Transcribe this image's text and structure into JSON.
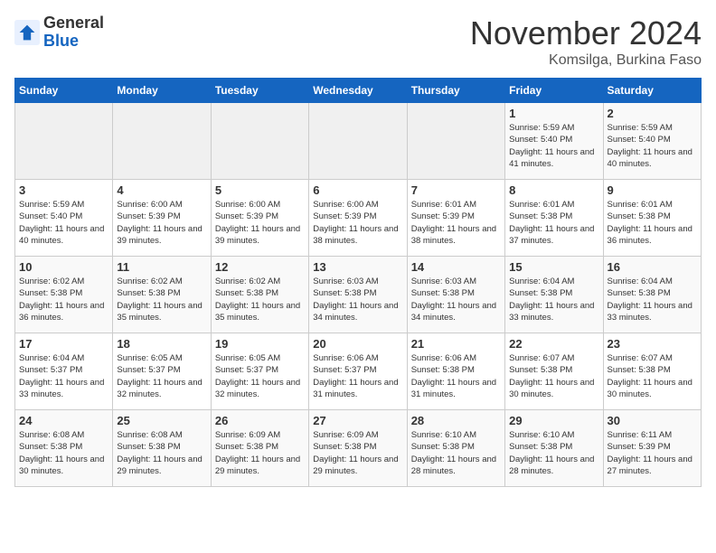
{
  "logo": {
    "general": "General",
    "blue": "Blue"
  },
  "title": "November 2024",
  "location": "Komsilga, Burkina Faso",
  "days_header": [
    "Sunday",
    "Monday",
    "Tuesday",
    "Wednesday",
    "Thursday",
    "Friday",
    "Saturday"
  ],
  "weeks": [
    [
      {
        "day": "",
        "info": ""
      },
      {
        "day": "",
        "info": ""
      },
      {
        "day": "",
        "info": ""
      },
      {
        "day": "",
        "info": ""
      },
      {
        "day": "",
        "info": ""
      },
      {
        "day": "1",
        "info": "Sunrise: 5:59 AM\nSunset: 5:40 PM\nDaylight: 11 hours and 41 minutes."
      },
      {
        "day": "2",
        "info": "Sunrise: 5:59 AM\nSunset: 5:40 PM\nDaylight: 11 hours and 40 minutes."
      }
    ],
    [
      {
        "day": "3",
        "info": "Sunrise: 5:59 AM\nSunset: 5:40 PM\nDaylight: 11 hours and 40 minutes."
      },
      {
        "day": "4",
        "info": "Sunrise: 6:00 AM\nSunset: 5:39 PM\nDaylight: 11 hours and 39 minutes."
      },
      {
        "day": "5",
        "info": "Sunrise: 6:00 AM\nSunset: 5:39 PM\nDaylight: 11 hours and 39 minutes."
      },
      {
        "day": "6",
        "info": "Sunrise: 6:00 AM\nSunset: 5:39 PM\nDaylight: 11 hours and 38 minutes."
      },
      {
        "day": "7",
        "info": "Sunrise: 6:01 AM\nSunset: 5:39 PM\nDaylight: 11 hours and 38 minutes."
      },
      {
        "day": "8",
        "info": "Sunrise: 6:01 AM\nSunset: 5:38 PM\nDaylight: 11 hours and 37 minutes."
      },
      {
        "day": "9",
        "info": "Sunrise: 6:01 AM\nSunset: 5:38 PM\nDaylight: 11 hours and 36 minutes."
      }
    ],
    [
      {
        "day": "10",
        "info": "Sunrise: 6:02 AM\nSunset: 5:38 PM\nDaylight: 11 hours and 36 minutes."
      },
      {
        "day": "11",
        "info": "Sunrise: 6:02 AM\nSunset: 5:38 PM\nDaylight: 11 hours and 35 minutes."
      },
      {
        "day": "12",
        "info": "Sunrise: 6:02 AM\nSunset: 5:38 PM\nDaylight: 11 hours and 35 minutes."
      },
      {
        "day": "13",
        "info": "Sunrise: 6:03 AM\nSunset: 5:38 PM\nDaylight: 11 hours and 34 minutes."
      },
      {
        "day": "14",
        "info": "Sunrise: 6:03 AM\nSunset: 5:38 PM\nDaylight: 11 hours and 34 minutes."
      },
      {
        "day": "15",
        "info": "Sunrise: 6:04 AM\nSunset: 5:38 PM\nDaylight: 11 hours and 33 minutes."
      },
      {
        "day": "16",
        "info": "Sunrise: 6:04 AM\nSunset: 5:38 PM\nDaylight: 11 hours and 33 minutes."
      }
    ],
    [
      {
        "day": "17",
        "info": "Sunrise: 6:04 AM\nSunset: 5:37 PM\nDaylight: 11 hours and 33 minutes."
      },
      {
        "day": "18",
        "info": "Sunrise: 6:05 AM\nSunset: 5:37 PM\nDaylight: 11 hours and 32 minutes."
      },
      {
        "day": "19",
        "info": "Sunrise: 6:05 AM\nSunset: 5:37 PM\nDaylight: 11 hours and 32 minutes."
      },
      {
        "day": "20",
        "info": "Sunrise: 6:06 AM\nSunset: 5:37 PM\nDaylight: 11 hours and 31 minutes."
      },
      {
        "day": "21",
        "info": "Sunrise: 6:06 AM\nSunset: 5:38 PM\nDaylight: 11 hours and 31 minutes."
      },
      {
        "day": "22",
        "info": "Sunrise: 6:07 AM\nSunset: 5:38 PM\nDaylight: 11 hours and 30 minutes."
      },
      {
        "day": "23",
        "info": "Sunrise: 6:07 AM\nSunset: 5:38 PM\nDaylight: 11 hours and 30 minutes."
      }
    ],
    [
      {
        "day": "24",
        "info": "Sunrise: 6:08 AM\nSunset: 5:38 PM\nDaylight: 11 hours and 30 minutes."
      },
      {
        "day": "25",
        "info": "Sunrise: 6:08 AM\nSunset: 5:38 PM\nDaylight: 11 hours and 29 minutes."
      },
      {
        "day": "26",
        "info": "Sunrise: 6:09 AM\nSunset: 5:38 PM\nDaylight: 11 hours and 29 minutes."
      },
      {
        "day": "27",
        "info": "Sunrise: 6:09 AM\nSunset: 5:38 PM\nDaylight: 11 hours and 29 minutes."
      },
      {
        "day": "28",
        "info": "Sunrise: 6:10 AM\nSunset: 5:38 PM\nDaylight: 11 hours and 28 minutes."
      },
      {
        "day": "29",
        "info": "Sunrise: 6:10 AM\nSunset: 5:38 PM\nDaylight: 11 hours and 28 minutes."
      },
      {
        "day": "30",
        "info": "Sunrise: 6:11 AM\nSunset: 5:39 PM\nDaylight: 11 hours and 27 minutes."
      }
    ]
  ]
}
